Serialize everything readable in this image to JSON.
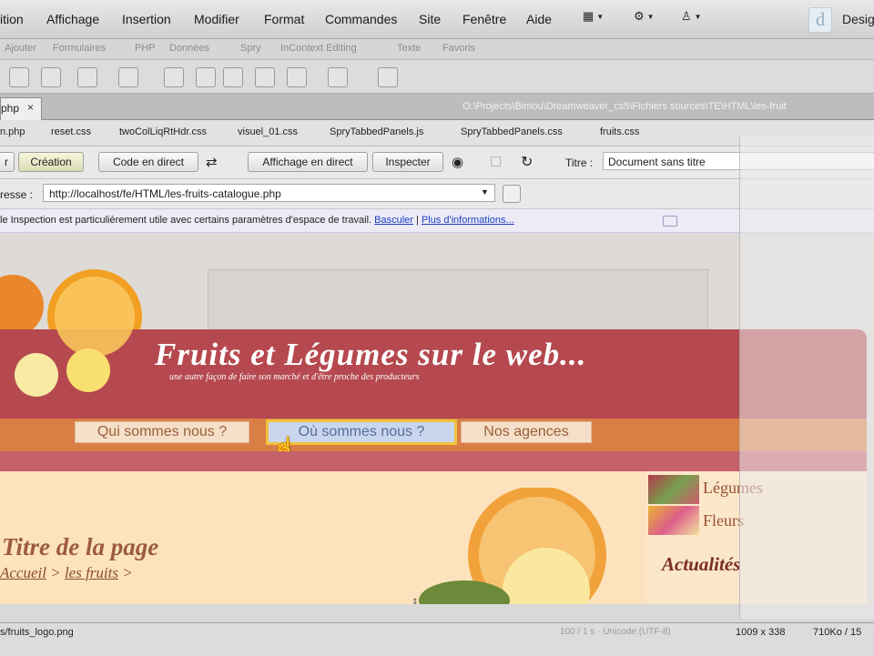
{
  "menu": {
    "items": [
      "ition",
      "Affichage",
      "Insertion",
      "Modifier",
      "Format",
      "Commandes",
      "Site",
      "Fenêtre",
      "Aide"
    ],
    "workspace": "Desig"
  },
  "insert_tabs": [
    "Ajouter",
    "Formulaires",
    "PHP",
    "Données",
    "Spry",
    "InContext Editing",
    "Texte",
    "Favoris"
  ],
  "doc_tab": {
    "label": "php",
    "close": "×"
  },
  "doc_path": "O:\\Projects\\Bimou\\Dreamweaver_cs5\\Fichiers sources\\TE\\HTML\\les-fruit",
  "related_files": [
    "n.php",
    "reset.css",
    "twoColLiqRtHdr.css",
    "visuel_01.css",
    "SpryTabbedPanels.js",
    "SpryTabbedPanels.css",
    "fruits.css"
  ],
  "doc_toolbar": {
    "split_partial": "r",
    "creation": "Création",
    "live_code": "Code en direct",
    "live_view": "Affichage en direct",
    "inspect": "Inspecter",
    "title_label": "Titre :",
    "title_value": "Document sans titre"
  },
  "address": {
    "label": "resse :",
    "value": "http://localhost/fe/HTML/les-fruits-catalogue.php"
  },
  "infobar": {
    "text": "le Inspection est particulièrement utile avec certains paramètres d'espace de travail.",
    "link_switch": "Basculer",
    "separator": "|",
    "link_more": "Plus d'informations..."
  },
  "page": {
    "site_title": "Fruits et Légumes sur le web...",
    "tagline": "une autre façon de faire son marché et d'être proche des producteurs",
    "nav": [
      "Qui sommes nous ?",
      "Où sommes nous ?",
      "Nos agences"
    ],
    "page_title": "Titre de la page",
    "breadcrumb": {
      "home": "Accueil",
      "sep1": ">",
      "current": "les fruits",
      "sep2": ">"
    },
    "side_items": [
      "Légumes",
      "Fleurs"
    ],
    "news_title": "Actualités"
  },
  "status": {
    "path": "s/fruits_logo.png",
    "faded": "100 / 1 s · Unicode (UTF-8)",
    "dimensions": "1009 x 338",
    "size": "710Ko / 15"
  },
  "colors": {
    "banner": "#b5494f",
    "nav_strip": "#d97f45",
    "content_bg": "#fde3bd",
    "link_blue": "#1a3fc6"
  }
}
